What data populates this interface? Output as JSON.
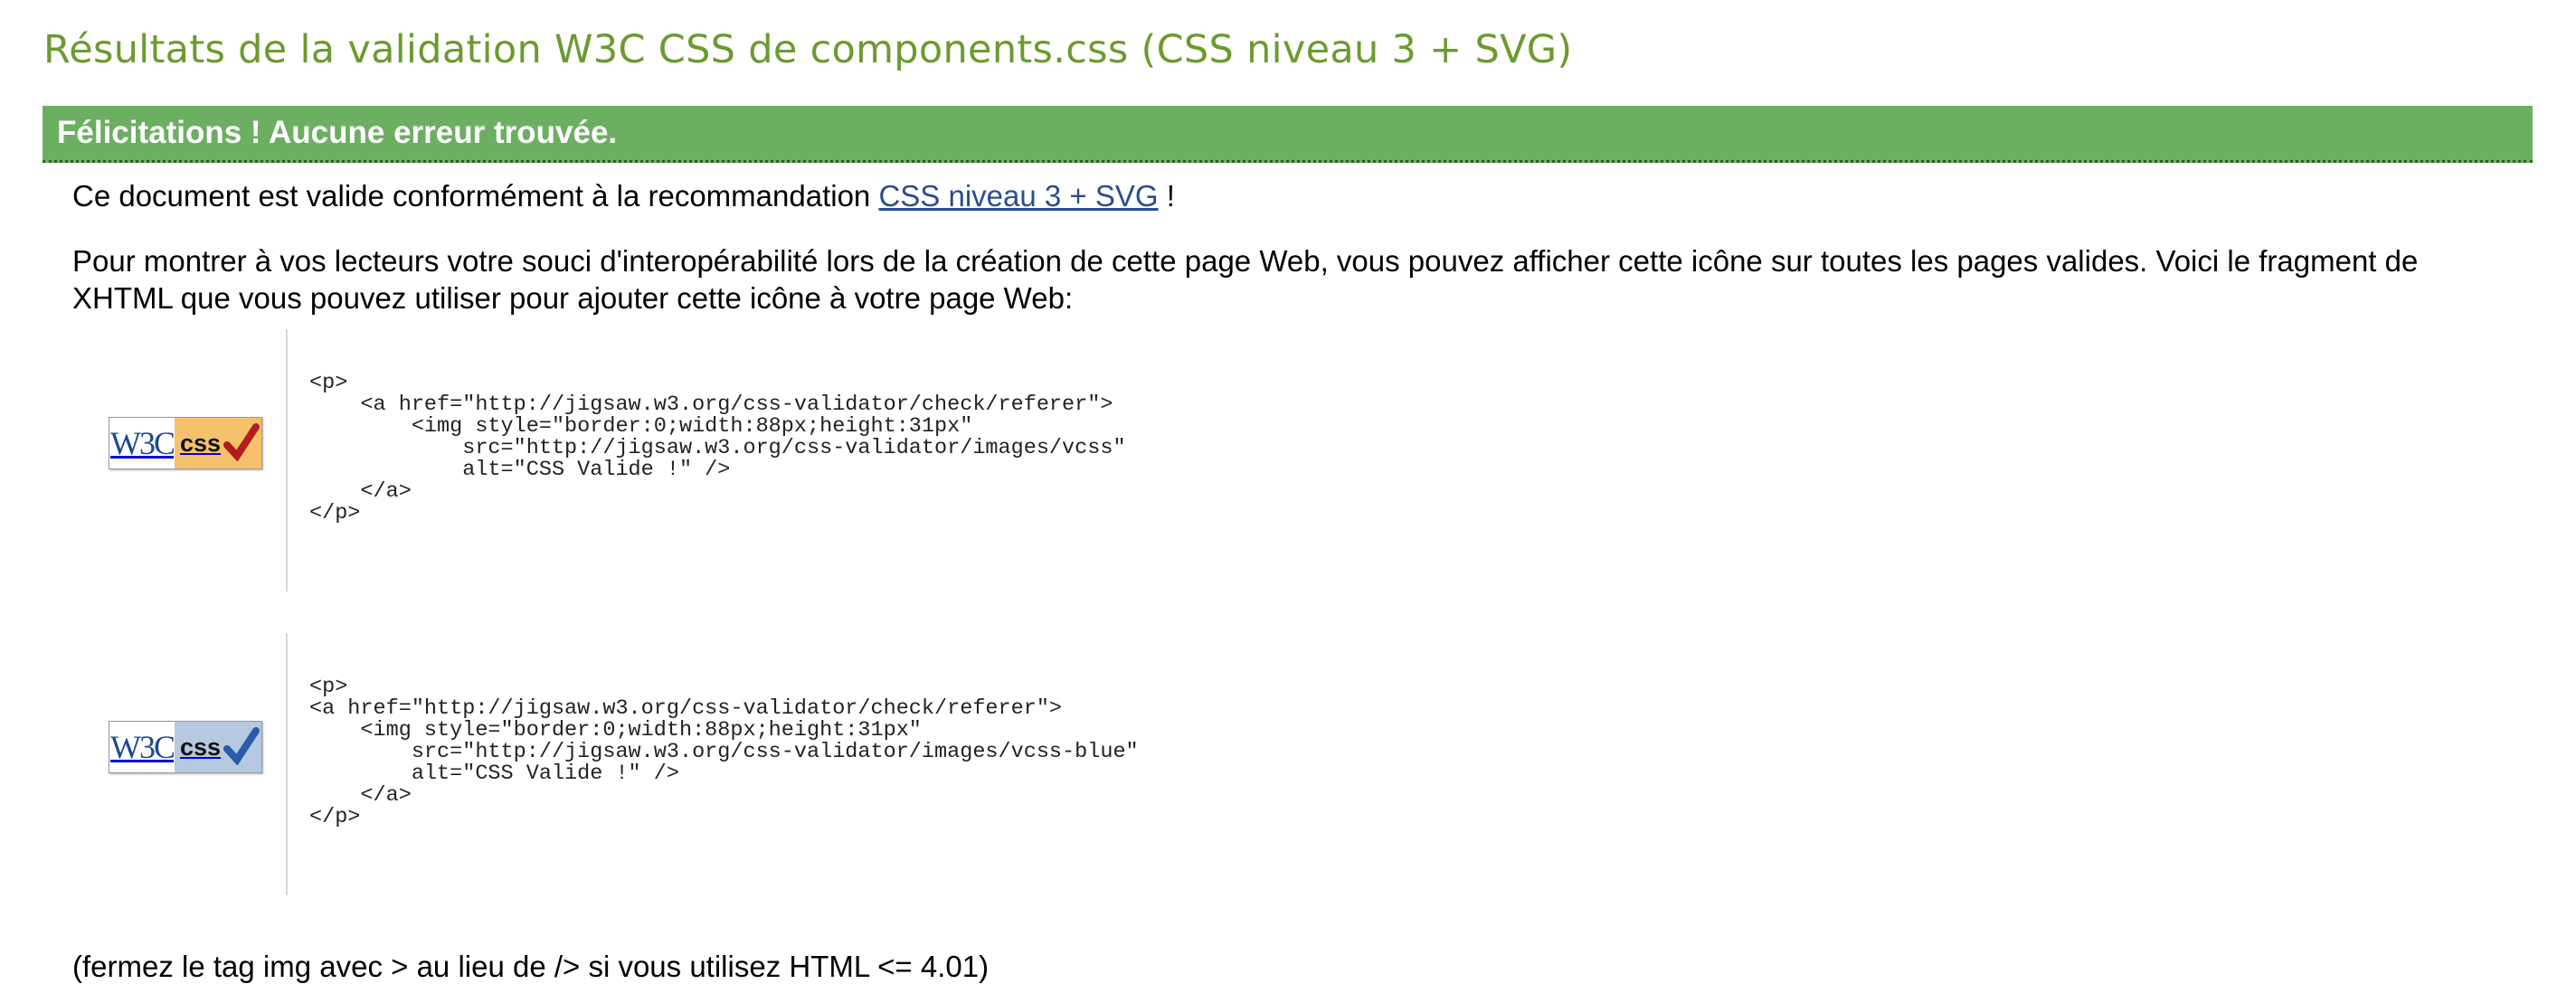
{
  "page": {
    "title": "Résultats de la validation W3C CSS de components.css (CSS niveau 3 + SVG)"
  },
  "banner": {
    "text": "Félicitations ! Aucune erreur trouvée."
  },
  "valid_message": {
    "prefix": "Ce document est valide conformément à la recommandation",
    "link_text": "CSS niveau 3 + SVG",
    "suffix": "!"
  },
  "interop_message": "Pour montrer à vos lecteurs votre souci d'interopérabilité lors de la création de cette page Web, vous pouvez afficher cette icône sur toutes les pages valides. Voici le fragment de XHTML que vous pouvez utiliser pour ajouter cette icône à votre page Web:",
  "badges": [
    {
      "w3c_text": "W3C",
      "css_text": "css",
      "color": "#f5c26b",
      "check_color": "#b21e1e",
      "icon": "w3c-css-valid-gold-icon",
      "code": "<p>\n    <a href=\"http://jigsaw.w3.org/css-validator/check/referer\">\n        <img style=\"border:0;width:88px;height:31px\"\n            src=\"http://jigsaw.w3.org/css-validator/images/vcss\"\n            alt=\"CSS Valide !\" />\n    </a>\n</p>"
    },
    {
      "w3c_text": "W3C",
      "css_text": "css",
      "color": "#b6c9e0",
      "check_color": "#2a5ba8",
      "icon": "w3c-css-valid-blue-icon",
      "code": "<p>\n<a href=\"http://jigsaw.w3.org/css-validator/check/referer\">\n    <img style=\"border:0;width:88px;height:31px\"\n        src=\"http://jigsaw.w3.org/css-validator/images/vcss-blue\"\n        alt=\"CSS Valide !\" />\n    </a>\n</p>"
    }
  ],
  "footnote": "(fermez le tag img avec > au lieu de /> si vous utilisez HTML <= 4.01)"
}
